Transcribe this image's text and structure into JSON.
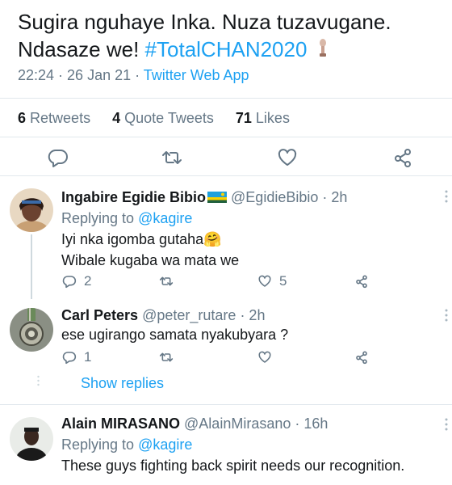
{
  "main_tweet": {
    "text_part1": "Sugira nguhaye Inka. Nuza tuzavugane. Ndasaze we!",
    "hashtag": "#TotalCHAN2020",
    "time": "22:24 · 26 Jan 21 · ",
    "app": "Twitter Web App"
  },
  "stats": {
    "retweets_count": "6",
    "retweets_label": "Retweets",
    "quotes_count": "4",
    "quotes_label": "Quote Tweets",
    "likes_count": "71",
    "likes_label": "Likes"
  },
  "icons": {
    "reply": "reply-icon",
    "retweet": "retweet-icon",
    "like": "heart-icon",
    "share": "share-icon",
    "more": "more-vertical-icon"
  },
  "colors": {
    "accent": "#1da1f2",
    "text": "#14171a",
    "muted": "#657786",
    "divider": "#e1e8ed"
  },
  "replies": [
    {
      "name": "Ingabire Egidie Bibio",
      "handle": "@EgidieBibio",
      "time": "· 2h",
      "replying_label": "Replying to",
      "replying_to": "@kagire",
      "line1": "Iyi nka igomba gutaha🤗",
      "line2": "Wibale kugaba wa mata we",
      "reply_count": "2",
      "like_count": "5"
    },
    {
      "name": "Carl Peters",
      "handle": "@peter_rutare",
      "time": "· 2h",
      "line1": "ese ugirango samata nyakubyara ?",
      "reply_count": "1",
      "show_replies": "Show replies"
    },
    {
      "name": "Alain MIRASANO",
      "handle": "@AlainMirasano",
      "time": "· 16h",
      "replying_label": "Replying to",
      "replying_to": "@kagire",
      "line1": "These guys fighting back spirit needs our recognition."
    }
  ]
}
